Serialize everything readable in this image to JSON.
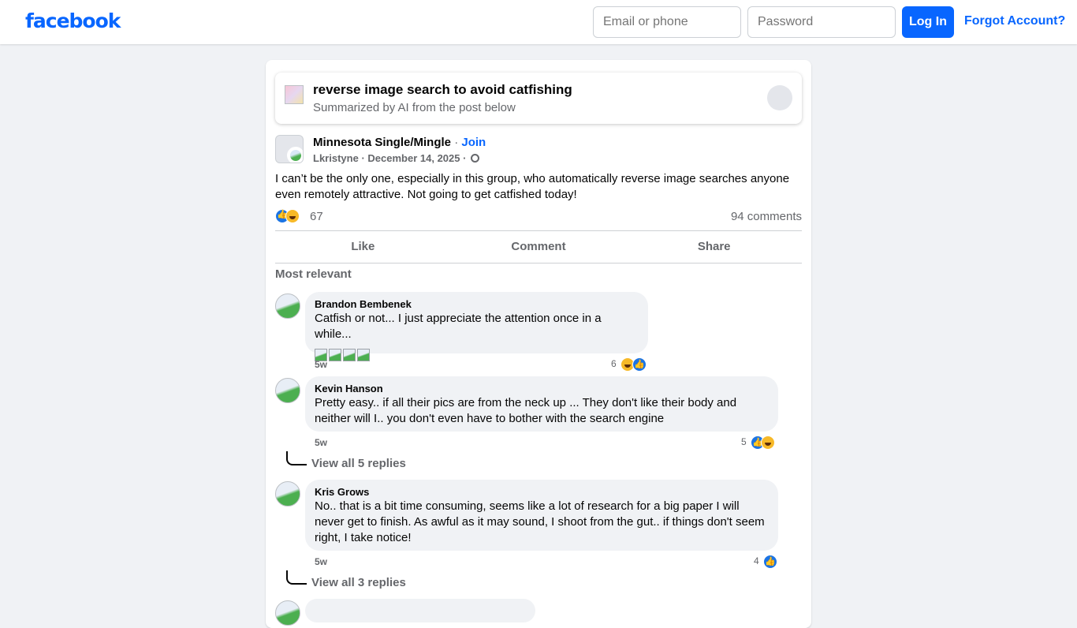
{
  "header": {
    "logo": "facebook",
    "email_placeholder": "Email or phone",
    "password_placeholder": "Password",
    "login_label": "Log In",
    "forgot_label": "Forgot Account?",
    "brand_color": "#0866ff"
  },
  "summary": {
    "title": "reverse image search to avoid catfishing",
    "subtitle": "Summarized by AI from the post below"
  },
  "post": {
    "group": "Minnesota Single/Mingle",
    "separator": "·",
    "join_label": "Join",
    "author": "Lkristyne",
    "date": "December 14, 2025",
    "text": "I can’t be the only one, especially in this group, who automatically reverse image searches anyone even remotely attractive. Not going to get catfished today!",
    "reaction_count": "67",
    "reaction_icons": [
      "like-icon",
      "haha-icon"
    ],
    "comments_count": "94 comments"
  },
  "actions": {
    "like": "Like",
    "comment": "Comment",
    "share": "Share"
  },
  "comments_sort": "Most relevant",
  "comments": [
    {
      "name": "Brandon Bembenek",
      "text": "Catfish or not... I just appreciate the attention once in a while...",
      "attached_images": 4,
      "time": "5w",
      "reaction_count": "6",
      "reaction_icons": [
        "haha-icon",
        "like-icon"
      ]
    },
    {
      "name": "Kevin Hanson",
      "text": "Pretty easy.. if all their pics are from the neck up ... They don't like their body and neither will I.. you don't even have to bother with the search engine",
      "time": "5w",
      "reaction_count": "5",
      "reaction_icons": [
        "like-icon",
        "haha-icon"
      ],
      "replies_label": "View all 5 replies"
    },
    {
      "name": "Kris Grows",
      "text": "No.. that is a bit time consuming, seems like a lot of research for a big paper I will never get to finish. As awful as it may sound, I shoot from the gut.. if things don't seem right, I take notice!",
      "time": "5w",
      "reaction_count": "4",
      "reaction_icons": [
        "like-icon"
      ],
      "replies_label": "View all 3 replies"
    }
  ]
}
